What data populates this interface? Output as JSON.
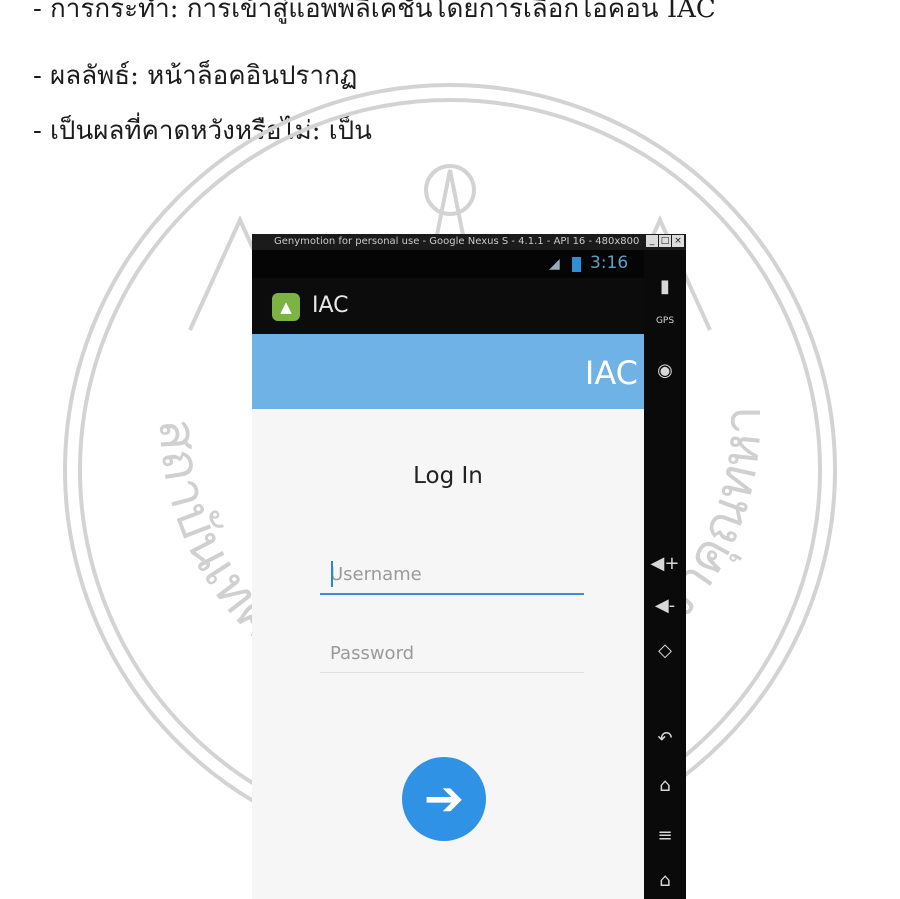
{
  "document": {
    "line1": "- การกระทำ: การเข้าสู่แอพพลิเคชั่นโดยการเลือกไอคอน IAC",
    "line2": "- ผลลัพธ์: หน้าล็อคอินปรากฏ",
    "line3": "- เป็นผลที่คาดหวังหรือไม่: เป็น"
  },
  "watermark": {
    "left_text": "สถาบันเทคโนโลยีพระจอมเกล้าเจ้าคุณทหารลาดกระบัง",
    "color": "#cfcfcf"
  },
  "emulator": {
    "title": "Genymotion for personal use - Google Nexus S - 4.1.1 - API 16 - 480x800",
    "controls": [
      "_",
      "□",
      "×"
    ],
    "status_time": "3:16",
    "app_icon": "android-icon",
    "app_name": "IAC",
    "banner_title": "IAC",
    "heading": "Log In",
    "username_placeholder": "Username",
    "password_placeholder": "Password",
    "submit_icon": "arrow-right-icon",
    "side_icons": [
      "battery-icon",
      "gps-icon",
      "camera-icon",
      "volume-up-icon",
      "volume-down-icon",
      "rotate-icon",
      "back-icon",
      "home-icon",
      "menu-icon",
      "home-outline-icon"
    ],
    "gps_label": "GPS",
    "accent_color": "#6fb2e5",
    "button_color": "#2f92e5"
  }
}
